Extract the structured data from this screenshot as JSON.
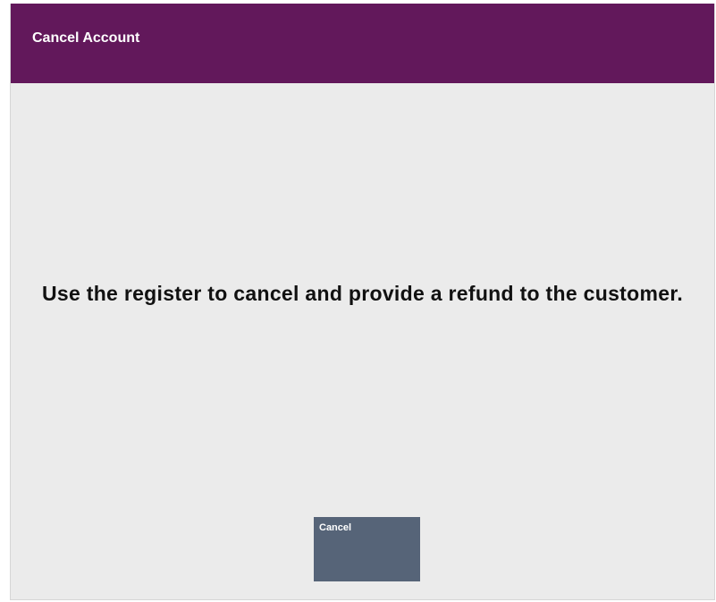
{
  "header": {
    "title": "Cancel Account"
  },
  "main": {
    "message": "Use the register to cancel and provide a refund to the customer."
  },
  "actions": {
    "cancel_label": "Cancel"
  },
  "colors": {
    "header_bg": "#62185b",
    "body_bg": "#ebebeb",
    "button_bg": "#566478",
    "header_text": "#ffffff",
    "message_text": "#111111"
  }
}
